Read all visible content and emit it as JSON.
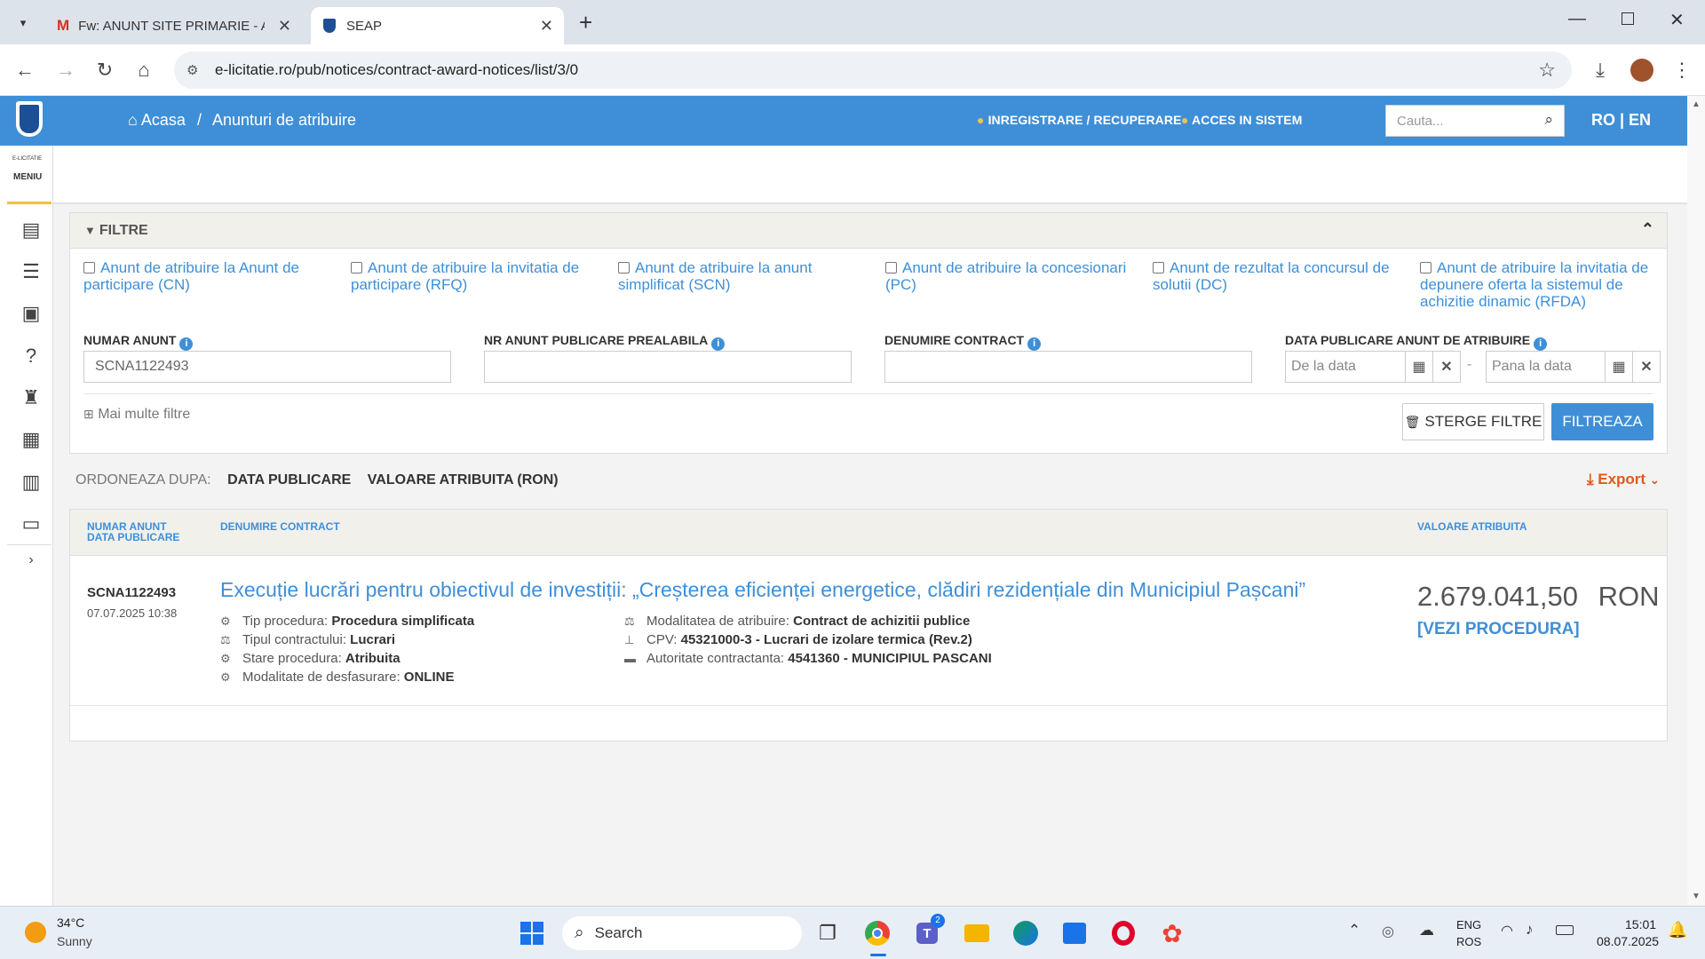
{
  "browser": {
    "tabs": [
      {
        "title": "Fw: ANUNT SITE PRIMARIE - AC"
      },
      {
        "title": "SEAP"
      }
    ],
    "url": "e-licitatie.ro/pub/notices/contract-award-notices/list/3/0"
  },
  "site": {
    "breadcrumb_home": "Acasa",
    "breadcrumb_sep": "/",
    "breadcrumb_page": "Anunturi de atribuire",
    "register_link": "INREGISTRARE / RECUPERARE",
    "login_link": "ACCES IN SISTEM",
    "search_placeholder": "Cauta...",
    "lang": "RO | EN",
    "menu_brand": "E-LICITATIE",
    "menu_label": "MENIU"
  },
  "filters": {
    "title": "FILTRE",
    "checkboxes": [
      "Anunt de atribuire la Anunt de participare (CN)",
      "Anunt de atribuire la invitatia de participare (RFQ)",
      "Anunt de atribuire la anunt simplificat (SCN)",
      "Anunt de atribuire la concesionari (PC)",
      "Anunt de rezultat la concursul de solutii (DC)",
      "Anunt de atribuire la invitatia de depunere oferta la sistemul de achizitie dinamic (RFDA)"
    ],
    "numar_label": "NUMAR ANUNT",
    "numar_value": "SCNA1122493",
    "prealabila_label": "NR ANUNT PUBLICARE PREALABILA",
    "denumire_label": "DENUMIRE CONTRACT",
    "data_label": "DATA PUBLICARE ANUNT DE ATRIBUIRE",
    "from_placeholder": "De la data",
    "to_placeholder": "Pana la data",
    "date_sep": "-",
    "more": "Mai multe filtre",
    "clear_button": "STERGE FILTRE",
    "filter_button": "FILTREAZA"
  },
  "sort": {
    "label": "ORDONEAZA DUPA:",
    "options": [
      "DATA PUBLICARE",
      "VALOARE ATRIBUITA (RON)"
    ],
    "export": "Export"
  },
  "results": {
    "headers": {
      "numar": "NUMAR ANUNT",
      "data": "DATA PUBLICARE",
      "denumire": "DENUMIRE CONTRACT",
      "valoare": "VALOARE ATRIBUITA"
    },
    "rows": [
      {
        "numar": "SCNA1122493",
        "data": "07.07.2025 10:38",
        "title": "Execuție lucrări pentru obiectivul de investiții: „Creșterea eficienței energetice, clădiri rezidențiale din Municipiul Pașcani”",
        "tip_label": "Tip procedura:",
        "tip_value": "Procedura simplificata",
        "contract_label": "Tipul contractului:",
        "contract_value": "Lucrari",
        "stare_label": "Stare procedura:",
        "stare_value": "Atribuita",
        "modalitate_label": "Modalitate de desfasurare:",
        "modalitate_value": "ONLINE",
        "atribuire_label": "Modalitatea de atribuire:",
        "atribuire_value": "Contract de achizitii publice",
        "cpv_label": "CPV:",
        "cpv_value": "45321000-3 - Lucrari de izolare termica (Rev.2)",
        "autoritate_label": "Autoritate contractanta:",
        "autoritate_value": "4541360 - MUNICIPIUL PASCANI",
        "valoare": "2.679.041,50",
        "currency": "RON",
        "vezi": "[VEZI PROCEDURA]"
      }
    ]
  },
  "taskbar": {
    "temp": "34°C",
    "weather": "Sunny",
    "search": "Search",
    "lang1": "ENG",
    "lang2": "ROS",
    "time": "15:01",
    "date": "08.07.2025",
    "teams_badge": "2"
  },
  "colors": {
    "accent": "#3f8fd8",
    "export": "#e05a1c"
  }
}
